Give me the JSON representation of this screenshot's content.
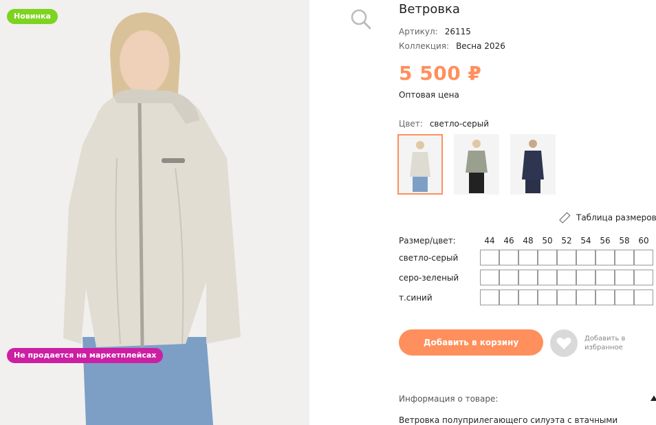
{
  "product": {
    "title": "Ветровка",
    "article_label": "Артикул:",
    "article_value": "26115",
    "collection_label": "Коллекция:",
    "collection_value": "Весна 2026",
    "price": "5 500 ₽",
    "price_note": "Оптовая цена",
    "color_label": "Цвет:",
    "color_value": "светло-серый"
  },
  "badges": {
    "new": "Новинка",
    "marketplace": "Не продается на маркетплейсах"
  },
  "thumbnails": [
    {
      "color": "#dedbd3"
    },
    {
      "color": "#9aa08e"
    },
    {
      "color": "#2e3550"
    }
  ],
  "size_table": {
    "link": "Таблица размеров",
    "header_label": "Размер/цвет:",
    "sizes": [
      "44",
      "46",
      "48",
      "50",
      "52",
      "54",
      "56",
      "58",
      "60"
    ],
    "rows": [
      "светло-серый",
      "серо-зеленый",
      "т.синий"
    ]
  },
  "actions": {
    "add_to_cart": "Добавить в корзину",
    "favorite_line1": "Добавить в",
    "favorite_line2": "избранное"
  },
  "info": {
    "title": "Информация о товаре:",
    "description": "Ветровка полуприлегающего силуэта с втачными"
  },
  "colors": {
    "accent": "#ff8f5c",
    "new_badge": "#7ed321",
    "market_badge": "#cc1fa3"
  }
}
